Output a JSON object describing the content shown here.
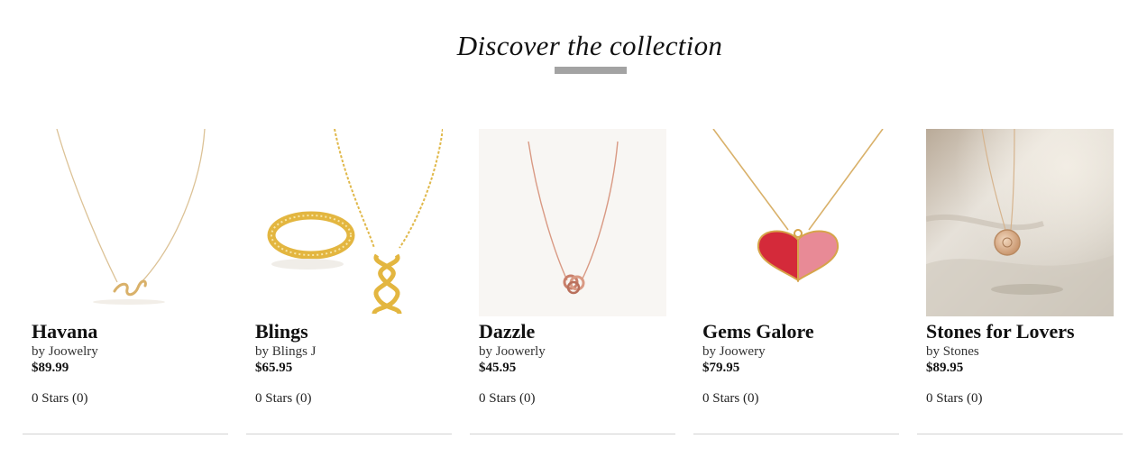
{
  "section": {
    "heading": "Discover the collection"
  },
  "products": [
    {
      "title": "Havana",
      "maker": "by Joowelry",
      "price": "$89.99",
      "rating": "0 Stars (0)"
    },
    {
      "title": "Blings",
      "maker": "by Blings J",
      "price": "$65.95",
      "rating": "0 Stars (0)"
    },
    {
      "title": "Dazzle",
      "maker": "by Joowerly",
      "price": "$45.95",
      "rating": "0 Stars (0)"
    },
    {
      "title": "Gems Galore",
      "maker": "by Joowery",
      "price": "$79.95",
      "rating": "0 Stars (0)"
    },
    {
      "title": "Stones for Lovers",
      "maker": "by Stones",
      "price": "$89.95",
      "rating": "0 Stars (0)"
    }
  ],
  "colors": {
    "heading_bar": "#a3a3a3",
    "gold": "#d9b16a",
    "rose_gold": "#d99a84",
    "enamel_red": "#d42a3a",
    "enamel_pink": "#e88a96"
  }
}
